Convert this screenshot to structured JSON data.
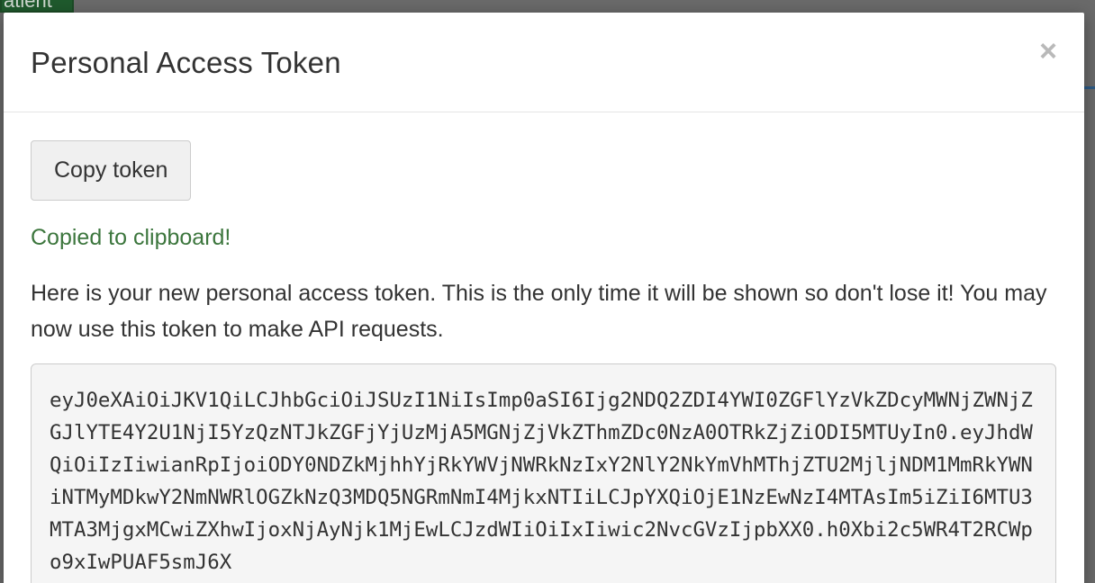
{
  "background": {
    "partial_tab_label": "atient"
  },
  "modal": {
    "title": "Personal Access Token",
    "close_symbol": "×",
    "copy_button_label": "Copy token",
    "copied_message": "Copied to clipboard!",
    "description": "Here is your new personal access token. This is the only time it will be shown so don't lose it! You may now use this token to make API requests.",
    "token": "eyJ0eXAiOiJKV1QiLCJhbGciOiJSUzI1NiIsImp0aSI6Ijg2NDQ2ZDI4YWI0ZGFlYzVkZDcyMWNjZWNjZGJlYTE4Y2U1NjI5YzQzNTJkZGFjYjUzMjA5MGNjZjVkZThmZDc0NzA0OTRkZjZiODI5MTUyIn0.eyJhdWQiOiIzIiwianRpIjoiODY0NDZkMjhhYjRkYWVjNWRkNzIxY2NlY2NkYmVhMThjZTU2MjljNDM1MmRkYWNiNTMyMDkwY2NmNWRlOGZkNzQ3MDQ5NGRmNmI4MjkxNTIiLCJpYXQiOjE1NzEwNzI4MTAsIm5iZiI6MTU3MTA3MjgxMCwiZXhwIjoxNjAyNjk1MjEwLCJzdWIiOiIxIiwic2NvcGVzIjpbXX0.h0Xbi2c5WR4T2RCWpo9xIwPUAF5smJ6X"
  },
  "colors": {
    "success_text": "#3c763d",
    "overlay": "#6a6a6a"
  },
  "icons": {
    "close": "close-icon"
  }
}
